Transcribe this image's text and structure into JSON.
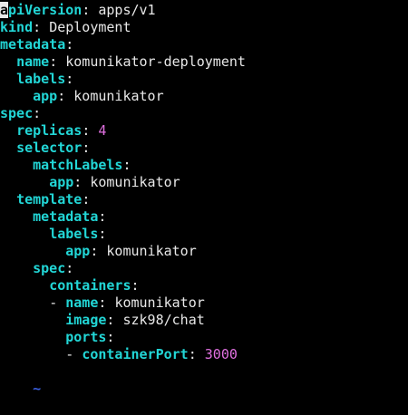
{
  "editor": {
    "cursor_char": "a",
    "lines": [
      {
        "indent": "",
        "key": "piVersion",
        "cursor_key": true,
        "sep": ": ",
        "value": "apps/v1",
        "type": "str"
      },
      {
        "indent": "",
        "key": "kind",
        "sep": ": ",
        "value": "Deployment",
        "type": "str"
      },
      {
        "indent": "",
        "key": "metadata",
        "sep": ":",
        "value": "",
        "type": "str"
      },
      {
        "indent": "  ",
        "key": "name",
        "sep": ": ",
        "value": "komunikator-deployment",
        "type": "str"
      },
      {
        "indent": "  ",
        "key": "labels",
        "sep": ":",
        "value": "",
        "type": "str"
      },
      {
        "indent": "    ",
        "key": "app",
        "sep": ": ",
        "value": "komunikator",
        "type": "str"
      },
      {
        "indent": "",
        "key": "spec",
        "sep": ":",
        "value": "",
        "type": "str"
      },
      {
        "indent": "  ",
        "key": "replicas",
        "sep": ": ",
        "value": "4",
        "type": "num"
      },
      {
        "indent": "  ",
        "key": "selector",
        "sep": ":",
        "value": "",
        "type": "str"
      },
      {
        "indent": "    ",
        "key": "matchLabels",
        "sep": ":",
        "value": "",
        "type": "str"
      },
      {
        "indent": "      ",
        "key": "app",
        "sep": ": ",
        "value": "komunikator",
        "type": "str"
      },
      {
        "indent": "  ",
        "key": "template",
        "sep": ":",
        "value": "",
        "type": "str"
      },
      {
        "indent": "    ",
        "key": "metadata",
        "sep": ":",
        "value": "",
        "type": "str"
      },
      {
        "indent": "      ",
        "key": "labels",
        "sep": ":",
        "value": "",
        "type": "str"
      },
      {
        "indent": "        ",
        "key": "app",
        "sep": ": ",
        "value": "komunikator",
        "type": "str"
      },
      {
        "indent": "    ",
        "key": "spec",
        "sep": ":",
        "value": "",
        "type": "str"
      },
      {
        "indent": "      ",
        "key": "containers",
        "sep": ":",
        "value": "",
        "type": "str"
      },
      {
        "indent": "      ",
        "dash": "- ",
        "key": "name",
        "sep": ": ",
        "value": "komunikator",
        "type": "str"
      },
      {
        "indent": "        ",
        "key": "image",
        "sep": ": ",
        "value": "szk98/chat",
        "type": "str"
      },
      {
        "indent": "        ",
        "key": "ports",
        "sep": ":",
        "value": "",
        "type": "str"
      },
      {
        "indent": "        ",
        "dash": "- ",
        "key": "containerPort",
        "sep": ": ",
        "value": "3000",
        "type": "num"
      }
    ],
    "empty_marker": "~"
  },
  "colors": {
    "background": "#000000",
    "key": "#22d6d6",
    "text": "#e8e8e8",
    "number": "#e070e0",
    "tilde": "#3a5fe0"
  }
}
